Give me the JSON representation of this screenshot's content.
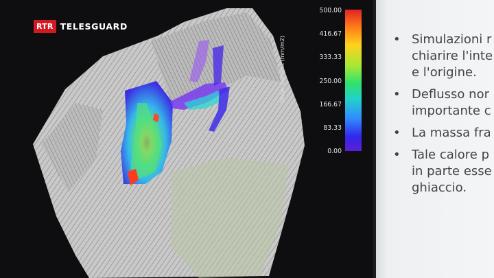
{
  "broadcaster": {
    "badge": "RTR",
    "name": "TELESGUARD"
  },
  "colorbar": {
    "label": "Water Content (mm/m2)",
    "ticks": [
      "500.00",
      "416.67",
      "333.33",
      "250.00",
      "166.67",
      "83.33",
      "0.00"
    ],
    "range": [
      0,
      500
    ]
  },
  "slide": {
    "bullets": [
      {
        "marker": "•",
        "text": "Simulazioni r\nchiarire l'inte\ne l'origine."
      },
      {
        "marker": "•",
        "text": "Deflusso nor\nimportante c"
      },
      {
        "marker": "•",
        "text": "La massa fra"
      },
      {
        "marker": "•",
        "text": "Tale calore p\nin parte esse\nghiaccio."
      }
    ]
  },
  "colors": {
    "logo_red": "#d31a21",
    "slide_text": "#3f4447"
  }
}
